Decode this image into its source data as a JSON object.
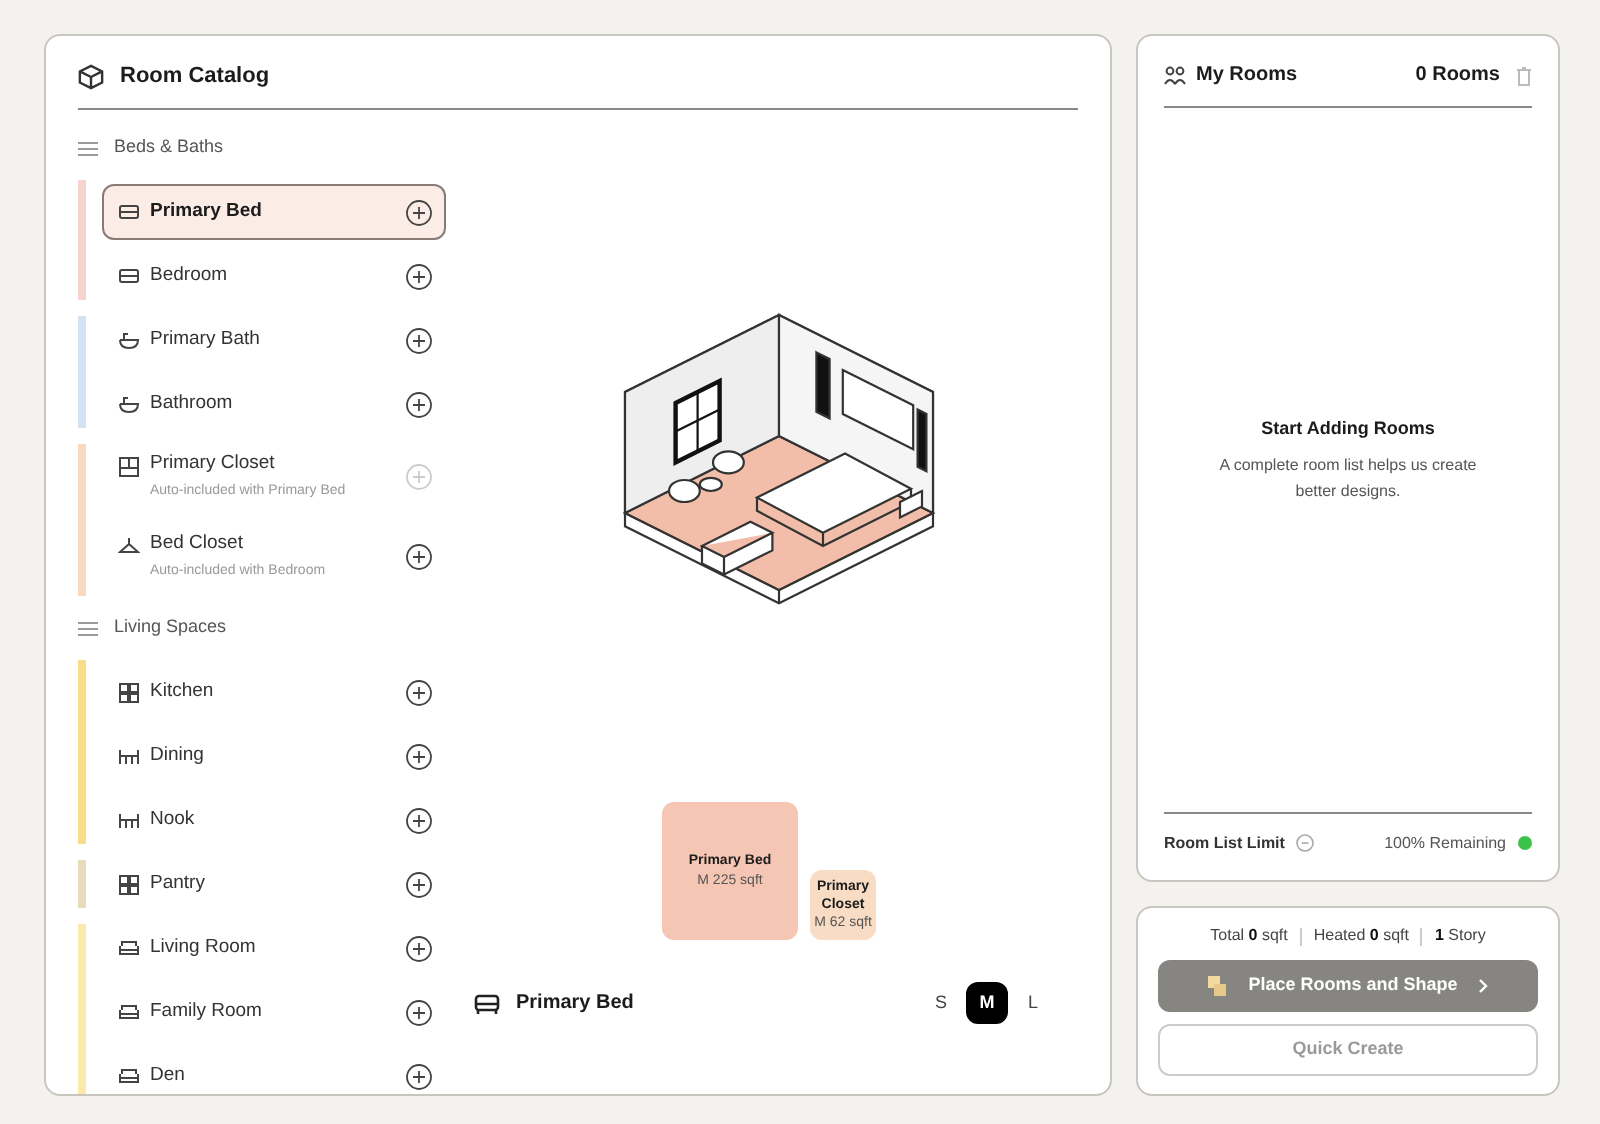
{
  "catalog": {
    "title": "Room Catalog",
    "groups": [
      {
        "heading": "Beds & Baths",
        "items": [
          {
            "label": "Primary Bed",
            "kind": "bed",
            "color": "#f5d5cb",
            "selected": true,
            "disabled": false
          },
          {
            "label": "Bedroom",
            "kind": "bed",
            "color": "#f5d5cb",
            "selected": false,
            "disabled": false
          },
          {
            "label": "Primary Bath",
            "kind": "bath",
            "color": "#d3e2f2",
            "selected": false,
            "disabled": false
          },
          {
            "label": "Bathroom",
            "kind": "bath",
            "color": "#d3e2f2",
            "selected": false,
            "disabled": false
          },
          {
            "label": "Primary Closet",
            "kind": "closet",
            "color": "#f8d8bf",
            "selected": false,
            "disabled": true,
            "note": "Auto-included with Primary Bed"
          },
          {
            "label": "Bed Closet",
            "kind": "hanger",
            "color": "#f8d8bf",
            "selected": false,
            "disabled": false,
            "note": "Auto-included with Bedroom"
          }
        ]
      },
      {
        "heading": "Living Spaces",
        "items": [
          {
            "label": "Kitchen",
            "kind": "grid",
            "color": "#f8de8a",
            "selected": false,
            "disabled": false
          },
          {
            "label": "Dining",
            "kind": "table",
            "color": "#f8de8a",
            "selected": false,
            "disabled": false
          },
          {
            "label": "Nook",
            "kind": "table",
            "color": "#f8de8a",
            "selected": false,
            "disabled": false
          },
          {
            "label": "Pantry",
            "kind": "grid",
            "color": "#e9dcbd",
            "selected": false,
            "disabled": false
          },
          {
            "label": "Living Room",
            "kind": "sofa",
            "color": "#fbeaaa",
            "selected": false,
            "disabled": false
          },
          {
            "label": "Family Room",
            "kind": "sofa",
            "color": "#fbeaaa",
            "selected": false,
            "disabled": false
          },
          {
            "label": "Den",
            "kind": "sofa",
            "color": "#fbeaaa",
            "selected": false,
            "disabled": false
          }
        ]
      }
    ],
    "tiles": [
      {
        "name": "Primary Bed",
        "size": "M 225 sqft",
        "color": "#f4c6b3",
        "kind": "large"
      },
      {
        "name": "Primary Closet",
        "size": "M 62 sqft",
        "color": "#f9dcc4",
        "kind": "small"
      }
    ],
    "footer": {
      "label": "Primary Bed",
      "sizes": [
        {
          "label": "S",
          "selected": false
        },
        {
          "label": "M",
          "selected": true
        },
        {
          "label": "L",
          "selected": false
        }
      ]
    }
  },
  "my_rooms": {
    "title": "My Rooms",
    "count": "0 Rooms",
    "empty_title": "Start Adding Rooms",
    "empty_text": "A complete room list helps us create better designs.",
    "limit_label": "Room List Limit",
    "remaining": "100% Remaining",
    "available": true
  },
  "summary": {
    "total_label": "Total",
    "total_value": "0",
    "total_unit": "sqft",
    "heated_label": "Heated",
    "heated_value": "0",
    "heated_unit": "sqft",
    "stories_value": "1",
    "stories_label": "Story",
    "primary_button": "Place Rooms and Shape",
    "secondary_button": "Quick Create"
  }
}
